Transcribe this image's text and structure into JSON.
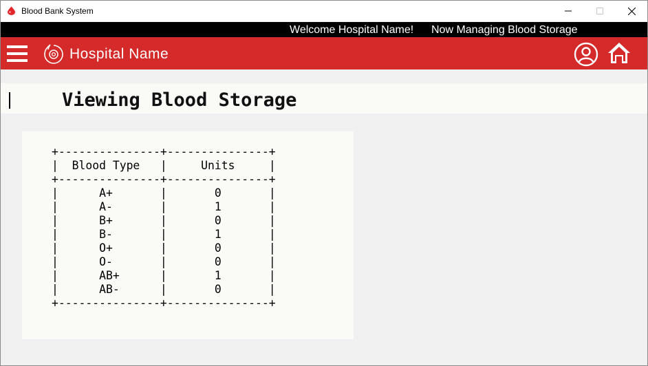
{
  "window": {
    "title": "Blood Bank System"
  },
  "infobar": {
    "welcome": "Welcome Hospital Name!",
    "managing": "Now Managing Blood Storage"
  },
  "header": {
    "hospital_name": "Hospital Name",
    "menu_icon": "hamburger-menu-icon",
    "logo_icon": "blood-drop-logo-icon",
    "profile_icon": "user-profile-icon",
    "home_icon": "home-icon"
  },
  "page": {
    "title": "Viewing Blood Storage"
  },
  "storage_table": {
    "headers": [
      "Blood Type",
      "Units"
    ],
    "rows": [
      {
        "type": "A+",
        "units": "0"
      },
      {
        "type": "A-",
        "units": "1"
      },
      {
        "type": "B+",
        "units": "0"
      },
      {
        "type": "B-",
        "units": "1"
      },
      {
        "type": "O+",
        "units": "0"
      },
      {
        "type": "O-",
        "units": "0"
      },
      {
        "type": "AB+",
        "units": "1"
      },
      {
        "type": "AB-",
        "units": "0"
      }
    ]
  },
  "colors": {
    "header_red": "#d42a2a",
    "infobar_black": "#000000",
    "panel_bg": "#fafaf7",
    "window_bg": "#f0f0f0"
  }
}
